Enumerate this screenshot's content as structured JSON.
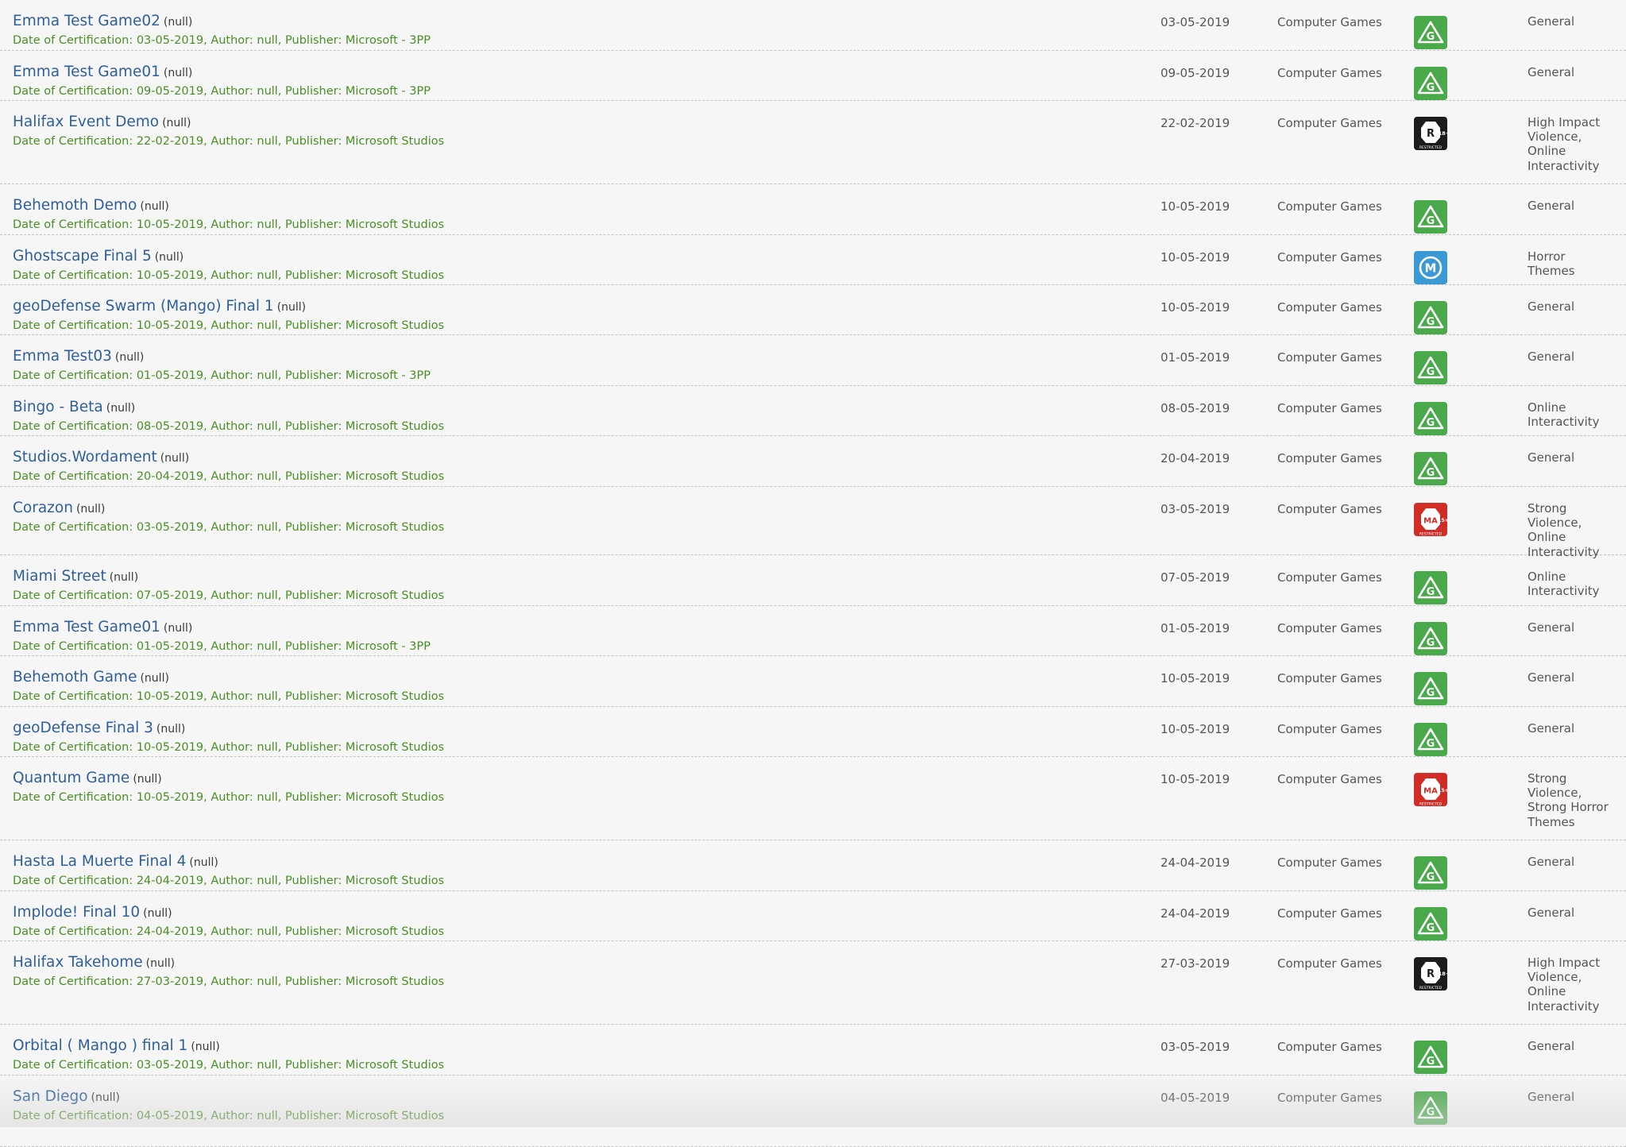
{
  "games": [
    {
      "title": "Emma Test Game02",
      "suffix": "(null)",
      "cert": "Date of Certification: 03-05-2019, Author: null, Publisher: Microsoft - 3PP",
      "date": "03-05-2019",
      "category": "Computer Games",
      "rating": "G",
      "rating_icon": "rating-g-icon",
      "descriptors": "General"
    },
    {
      "title": "Emma Test Game01",
      "suffix": "(null)",
      "cert": "Date of Certification: 09-05-2019, Author: null, Publisher: Microsoft - 3PP",
      "date": "09-05-2019",
      "category": "Computer Games",
      "rating": "G",
      "rating_icon": "rating-g-icon",
      "descriptors": "General"
    },
    {
      "title": "Halifax Event Demo",
      "suffix": "(null)",
      "cert": "Date of Certification: 22-02-2019, Author: null, Publisher: Microsoft Studios",
      "date": "22-02-2019",
      "category": "Computer Games",
      "rating": "R",
      "rating_icon": "rating-r18-icon",
      "descriptors": "High Impact Violence, Online Interactivity"
    },
    {
      "title": "Behemoth Demo",
      "suffix": "(null)",
      "cert": "Date of Certification: 10-05-2019, Author: null, Publisher: Microsoft Studios",
      "date": "10-05-2019",
      "category": "Computer Games",
      "rating": "G",
      "rating_icon": "rating-g-icon",
      "descriptors": "General"
    },
    {
      "title": "Ghostscape Final 5",
      "suffix": "(null)",
      "cert": "Date of Certification: 10-05-2019, Author: null, Publisher: Microsoft Studios",
      "date": "10-05-2019",
      "category": "Computer Games",
      "rating": "M",
      "rating_icon": "rating-m-icon",
      "descriptors": "Horror Themes"
    },
    {
      "title": "geoDefense Swarm (Mango) Final 1",
      "suffix": "(null)",
      "cert": "Date of Certification: 10-05-2019, Author: null, Publisher: Microsoft Studios",
      "date": "10-05-2019",
      "category": "Computer Games",
      "rating": "G",
      "rating_icon": "rating-g-icon",
      "descriptors": "General"
    },
    {
      "title": "Emma Test03",
      "suffix": "(null)",
      "cert": "Date of Certification: 01-05-2019, Author: null, Publisher: Microsoft - 3PP",
      "date": "01-05-2019",
      "category": "Computer Games",
      "rating": "G",
      "rating_icon": "rating-g-icon",
      "descriptors": "General"
    },
    {
      "title": "Bingo - Beta",
      "suffix": "(null)",
      "cert": "Date of Certification: 08-05-2019, Author: null, Publisher: Microsoft Studios",
      "date": "08-05-2019",
      "category": "Computer Games",
      "rating": "G",
      "rating_icon": "rating-g-icon",
      "descriptors": "Online Interactivity"
    },
    {
      "title": "Studios.Wordament",
      "suffix": "(null)",
      "cert": "Date of Certification: 20-04-2019, Author: null, Publisher: Microsoft Studios",
      "date": "20-04-2019",
      "category": "Computer Games",
      "rating": "G",
      "rating_icon": "rating-g-icon",
      "descriptors": "General"
    },
    {
      "title": "Corazon",
      "suffix": "(null)",
      "cert": "Date of Certification: 03-05-2019, Author: null, Publisher: Microsoft Studios",
      "date": "03-05-2019",
      "category": "Computer Games",
      "rating": "MA",
      "rating_icon": "rating-ma15-icon",
      "descriptors": "Strong Violence, Online Interactivity"
    },
    {
      "title": "Miami Street",
      "suffix": "(null)",
      "cert": "Date of Certification: 07-05-2019, Author: null, Publisher: Microsoft Studios",
      "date": "07-05-2019",
      "category": "Computer Games",
      "rating": "G",
      "rating_icon": "rating-g-icon",
      "descriptors": "Online Interactivity"
    },
    {
      "title": "Emma Test Game01",
      "suffix": "(null)",
      "cert": "Date of Certification: 01-05-2019, Author: null, Publisher: Microsoft - 3PP",
      "date": "01-05-2019",
      "category": "Computer Games",
      "rating": "G",
      "rating_icon": "rating-g-icon",
      "descriptors": "General"
    },
    {
      "title": "Behemoth Game",
      "suffix": "(null)",
      "cert": "Date of Certification: 10-05-2019, Author: null, Publisher: Microsoft Studios",
      "date": "10-05-2019",
      "category": "Computer Games",
      "rating": "G",
      "rating_icon": "rating-g-icon",
      "descriptors": "General"
    },
    {
      "title": "geoDefense Final 3",
      "suffix": "(null)",
      "cert": "Date of Certification: 10-05-2019, Author: null, Publisher: Microsoft Studios",
      "date": "10-05-2019",
      "category": "Computer Games",
      "rating": "G",
      "rating_icon": "rating-g-icon",
      "descriptors": "General"
    },
    {
      "title": "Quantum Game",
      "suffix": "(null)",
      "cert": "Date of Certification: 10-05-2019, Author: null, Publisher: Microsoft Studios",
      "date": "10-05-2019",
      "category": "Computer Games",
      "rating": "MA",
      "rating_icon": "rating-ma15-icon",
      "descriptors": "Strong Violence, Strong Horror Themes"
    },
    {
      "title": "Hasta La Muerte Final 4",
      "suffix": "(null)",
      "cert": "Date of Certification: 24-04-2019, Author: null, Publisher: Microsoft Studios",
      "date": "24-04-2019",
      "category": "Computer Games",
      "rating": "G",
      "rating_icon": "rating-g-icon",
      "descriptors": "General"
    },
    {
      "title": "Implode! Final 10",
      "suffix": "(null)",
      "cert": "Date of Certification: 24-04-2019, Author: null, Publisher: Microsoft Studios",
      "date": "24-04-2019",
      "category": "Computer Games",
      "rating": "G",
      "rating_icon": "rating-g-icon",
      "descriptors": "General"
    },
    {
      "title": "Halifax Takehome",
      "suffix": "(null)",
      "cert": "Date of Certification: 27-03-2019, Author: null, Publisher: Microsoft Studios",
      "date": "27-03-2019",
      "category": "Computer Games",
      "rating": "R",
      "rating_icon": "rating-r18-icon",
      "descriptors": "High Impact Violence, Online Interactivity"
    },
    {
      "title": "Orbital ( Mango ) final 1",
      "suffix": "(null)",
      "cert": "Date of Certification: 03-05-2019, Author: null, Publisher: Microsoft Studios",
      "date": "03-05-2019",
      "category": "Computer Games",
      "rating": "G",
      "rating_icon": "rating-g-icon",
      "descriptors": "General"
    },
    {
      "title": "San Diego",
      "suffix": "(null)",
      "cert": "Date of Certification: 04-05-2019, Author: null, Publisher: Microsoft Studios",
      "date": "04-05-2019",
      "category": "Computer Games",
      "rating": "G",
      "rating_icon": "rating-g-icon",
      "descriptors": "General"
    }
  ],
  "rating_colors": {
    "G": "#49a94b",
    "M": "#3b9ad6",
    "MA": "#d22c26",
    "R": "#1c1c1c"
  },
  "badge_text": {
    "r_age": "18+",
    "ma_age": "15+",
    "restricted": "RESTRICTED"
  }
}
